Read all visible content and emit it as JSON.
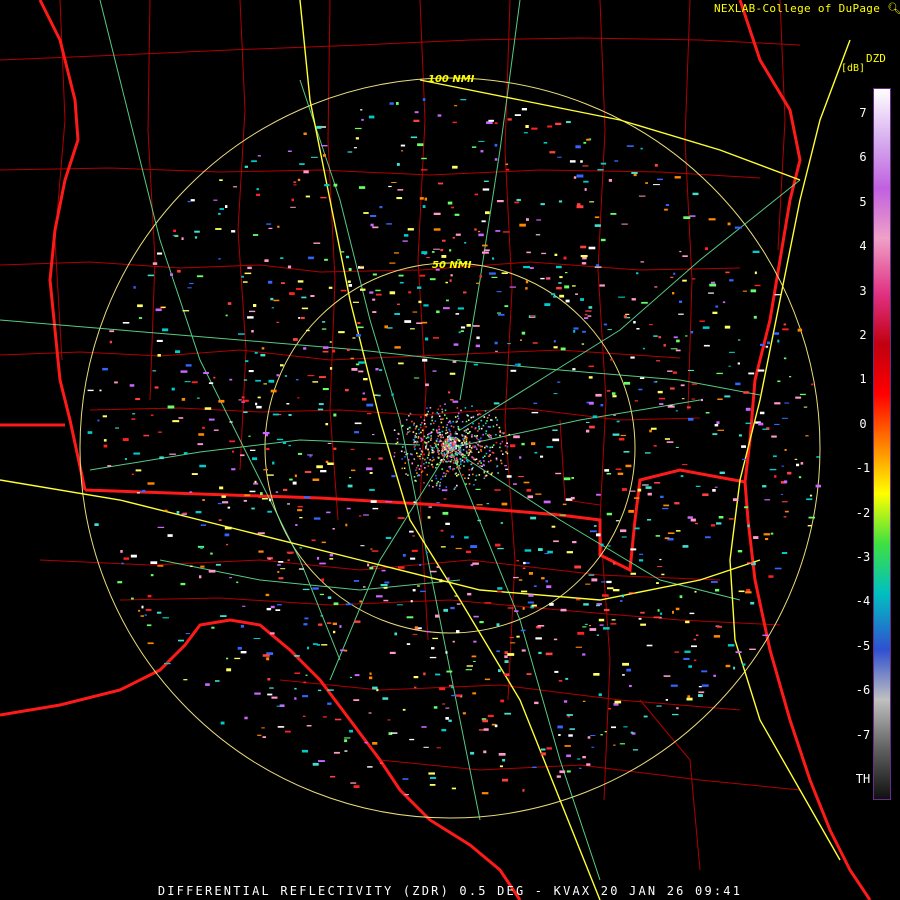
{
  "credit": "NEXLAB-College of DuPage",
  "credit_icon": "magnifier-icon",
  "legend": {
    "product": "DZD",
    "units": "[dB]",
    "ticks": [
      "7",
      "6",
      "5",
      "4",
      "3",
      "2",
      "1",
      "0",
      "-1",
      "-2",
      "-3",
      "-4",
      "-5",
      "-6",
      "-7",
      "TH"
    ],
    "colors": [
      "#ffffff",
      "#d8b0f0",
      "#c060e0",
      "#f0a0c8",
      "#e03080",
      "#c00010",
      "#ff0000",
      "#ff8000",
      "#ffff00",
      "#40e040",
      "#00c0c0",
      "#3050d0",
      "#c0c0c0",
      "#606060",
      "#101010"
    ]
  },
  "range_rings": [
    {
      "label": "100 NMI",
      "radius_nmi": 100
    },
    {
      "label": "50 NMI",
      "radius_nmi": 50
    }
  ],
  "map_colors": {
    "state_border": "#ff1a1a",
    "county_lines": "#cc0000",
    "highways": "#ffff33",
    "roads": "#66ee99",
    "rings": "#e8dc7a"
  },
  "status_bar": "DIFFERENTIAL REFLECTIVITY (ZDR) 0.5 DEG - KVAX 20 JAN 26 09:41"
}
